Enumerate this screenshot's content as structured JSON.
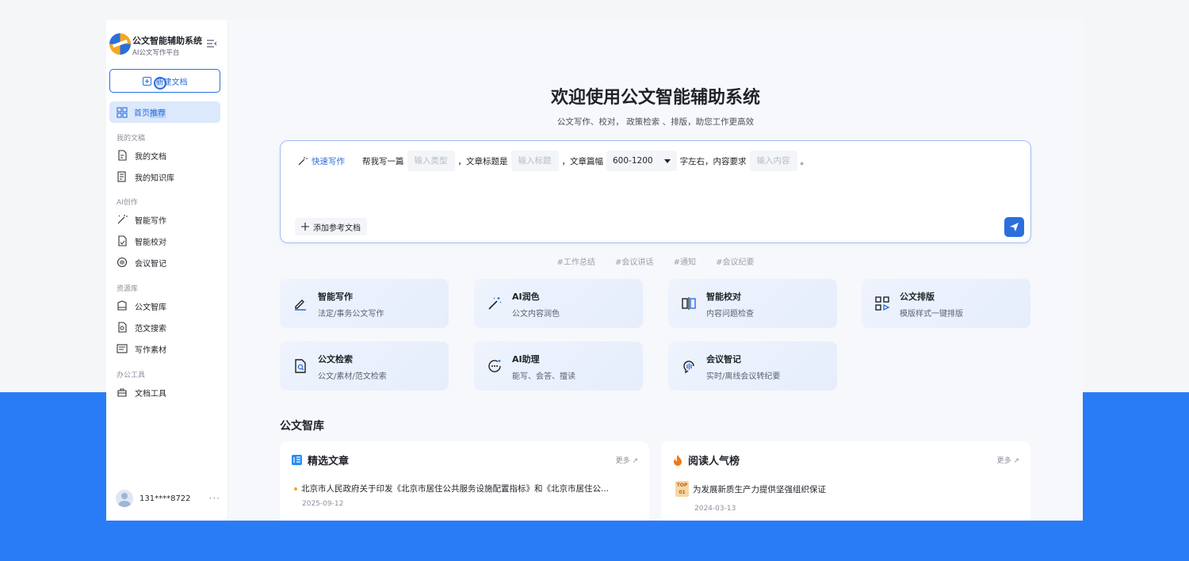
{
  "brand": {
    "title": "公文智能辅助系统",
    "subtitle": "AI公文写作平台"
  },
  "sidebar": {
    "new_doc": "新建文档",
    "home_prefix": "首页",
    "home_highlight": "推荐",
    "sections": [
      {
        "label": "我的文稿",
        "items": [
          "我的文档",
          "我的知识库"
        ]
      },
      {
        "label": "AI创作",
        "items": [
          "智能写作",
          "智能校对",
          "会议智记"
        ]
      },
      {
        "label": "资源库",
        "items": [
          "公文智库",
          "范文搜索",
          "写作素材"
        ]
      },
      {
        "label": "办公工具",
        "items": [
          "文档工具"
        ]
      }
    ],
    "user": "131****8722",
    "more": "···"
  },
  "hero": {
    "title": "欢迎使用公文智能辅助系统",
    "subtitle": "公文写作、校对， 政策检索 、排版，助您工作更高效"
  },
  "composer": {
    "quick_tag": "快速写作",
    "p1": "帮我写一篇",
    "type_placeholder": "输入类型",
    "p2": "，文章标题是",
    "title_placeholder": "输入标题",
    "p3": "，文章篇幅",
    "length_value": "600-1200",
    "p4": "字左右，内容要求",
    "content_placeholder": "输入内容",
    "p5": "。",
    "add_ref": "添加参考文档"
  },
  "hashtags": [
    "#工作总结",
    "#会议讲话",
    "#通知",
    "#会议纪要"
  ],
  "features": [
    {
      "title": "智能写作",
      "desc": "法定/事务公文写作",
      "icon": "pen-icon"
    },
    {
      "title": "AI润色",
      "desc": "公文内容润色",
      "icon": "magic-wand-icon"
    },
    {
      "title": "智能校对",
      "desc": "内容问题检查",
      "icon": "compare-icon"
    },
    {
      "title": "公文排版",
      "desc": "模版样式一键排版",
      "icon": "layout-icon"
    },
    {
      "title": "公文检索",
      "desc": "公文/素材/范文检索",
      "icon": "doc-search-icon"
    },
    {
      "title": "AI助理",
      "desc": "能写、会答、擅读",
      "icon": "chat-icon"
    },
    {
      "title": "会议智记",
      "desc": "实时/离线会议转纪要",
      "icon": "meeting-record-icon"
    }
  ],
  "library": {
    "title": "公文智库",
    "featured": {
      "title": "精选文章",
      "more": "更多 ↗",
      "article": "北京市人民政府关于印发《北京市居住公共服务设施配置指标》和《北京市居住公...",
      "date": "2025-09-12"
    },
    "popular": {
      "title": "阅读人气榜",
      "more": "更多 ↗",
      "badge_top": "TOP",
      "badge_num": "01",
      "article": "为发展新质生产力提供坚强组织保证",
      "date": "2024-03-13"
    }
  },
  "colors": {
    "accent": "#2a6fdb",
    "backdrop": "#2a7cf6",
    "badge": "#f7d7a6"
  }
}
